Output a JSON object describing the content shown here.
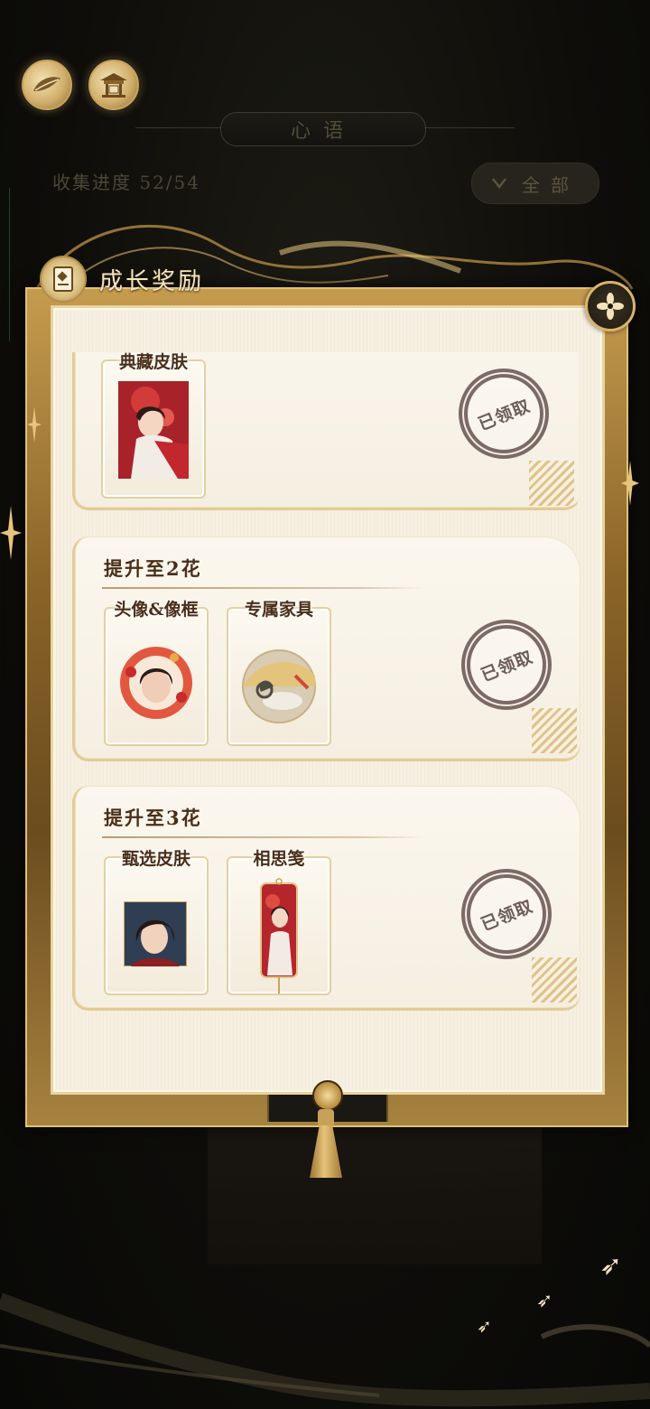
{
  "background": {
    "title": "心语",
    "progress_label": "收集进度 52/54",
    "filter_label": "全部"
  },
  "modal": {
    "title": "成长奖励",
    "cards": [
      {
        "title": "",
        "rewards": [
          {
            "label": "典藏皮肤",
            "icon": "skin-card-icon"
          }
        ],
        "status": "已领取"
      },
      {
        "title": "提升至2花",
        "rewards": [
          {
            "label": "头像&像框",
            "icon": "avatar-frame-icon"
          },
          {
            "label": "专属家具",
            "icon": "furniture-icon"
          }
        ],
        "status": "已领取"
      },
      {
        "title": "提升至3花",
        "rewards": [
          {
            "label": "甄选皮肤",
            "icon": "portrait-skin-icon"
          },
          {
            "label": "相思笺",
            "icon": "bookmark-card-icon"
          }
        ],
        "status": "已领取"
      }
    ]
  },
  "colors": {
    "gold": "#c9a45a",
    "paper": "#f6f0e2",
    "text_brown": "#4a2e19",
    "stamp_gray": "#7b6a66"
  }
}
